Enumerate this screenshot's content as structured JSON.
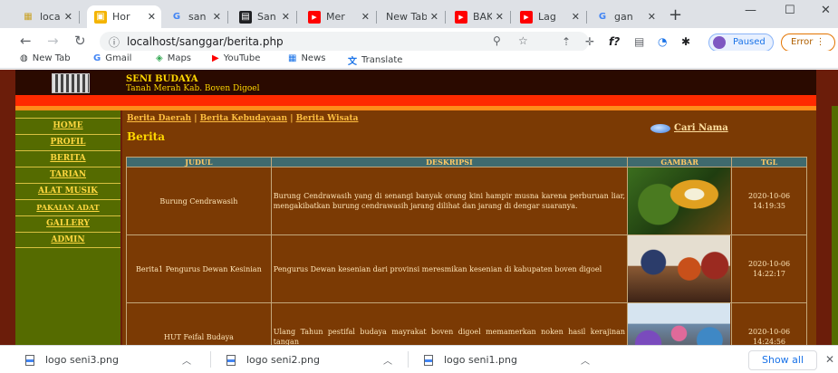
{
  "tabs": [
    {
      "title": "loca",
      "icon": "localhost-icon",
      "active": false
    },
    {
      "title": "Hor",
      "icon": "home-icon",
      "active": true
    },
    {
      "title": "san",
      "icon": "google-icon",
      "active": false
    },
    {
      "title": "San",
      "icon": "image-icon",
      "active": false
    },
    {
      "title": "Mer",
      "icon": "youtube-icon",
      "active": false
    },
    {
      "title": "New Tab",
      "icon": "",
      "active": false
    },
    {
      "title": "BAK",
      "icon": "youtube-icon",
      "active": false
    },
    {
      "title": "Lag",
      "icon": "youtube-icon",
      "active": false
    },
    {
      "title": "gan",
      "icon": "google-icon",
      "active": false
    }
  ],
  "newtab_label": "+",
  "window_controls": {
    "minimize": "—",
    "maximize": "☐",
    "close": "✕"
  },
  "toolbar": {
    "url": "localhost/sanggar/berita.php",
    "paused_label": "Paused",
    "error_label": "Error"
  },
  "bookmarks": [
    {
      "label": "New Tab",
      "icon": "globe-icon"
    },
    {
      "label": "Gmail",
      "icon": "google-icon"
    },
    {
      "label": "Maps",
      "icon": "maps-icon"
    },
    {
      "label": "YouTube",
      "icon": "youtube-icon"
    },
    {
      "label": "News",
      "icon": "news-icon"
    },
    {
      "label": "Translate",
      "icon": "translate-icon"
    }
  ],
  "site": {
    "title": "SENI BUDAYA",
    "subtitle": "Tanah Merah Kab. Boven Digoel",
    "menu": [
      "HOME",
      "PROFIL",
      "BERITA",
      "TARIAN",
      "ALAT MUSIK",
      "PAKAIAN ADAT",
      "GALLERY",
      "ADMIN"
    ],
    "category_links": [
      "Berita Daerah",
      "Berita Kebudayaan",
      "Berita Wisata"
    ],
    "section_title": "Berita",
    "search_link": "Cari Nama",
    "table": {
      "headers": [
        "JUDUL",
        "DESKRIPSI",
        "GAMBAR",
        "TGL"
      ],
      "rows": [
        {
          "judul": "Burung Cendrawasih",
          "deskripsi": "Burung Cendrawasih yang di senangi banyak orang kini hampir musna karena perburuan liar, mengakibatkan burung cendrawasih jarang dilihat dan jarang di dengar suaranya.",
          "gambar": "bird-of-paradise-image",
          "tgl_date": "2020-10-06",
          "tgl_time": "14:19:35"
        },
        {
          "judul": "Berita1 Pengurus Dewan Kesinian",
          "deskripsi": "Pengurus Dewan kesenian dari provinsi meresmikan kesenian di kabupaten boven digoel",
          "gambar": "ceremony-photo-image",
          "tgl_date": "2020-10-06",
          "tgl_time": "14:22:17"
        },
        {
          "judul": "HUT Feifal Budaya",
          "deskripsi": "Ulang Tahun pestifal budaya mayrakat boven digoel memamerkan noken hasil kerajinan tangan",
          "gambar": "festival-crowd-image",
          "tgl_date": "2020-10-06",
          "tgl_time": "14:24:56"
        }
      ]
    }
  },
  "downloads": [
    {
      "filename": "logo seni3.png"
    },
    {
      "filename": "logo seni2.png"
    },
    {
      "filename": "logo seni1.png"
    }
  ],
  "show_all_label": "Show all",
  "colors": {
    "page_bg": "#6b1d0a",
    "sidebar": "#556b00",
    "main": "#7b3a04",
    "table_header": "#3f6a6e",
    "red_bar": "#ff2a00",
    "gold_text": "#ffd700"
  }
}
